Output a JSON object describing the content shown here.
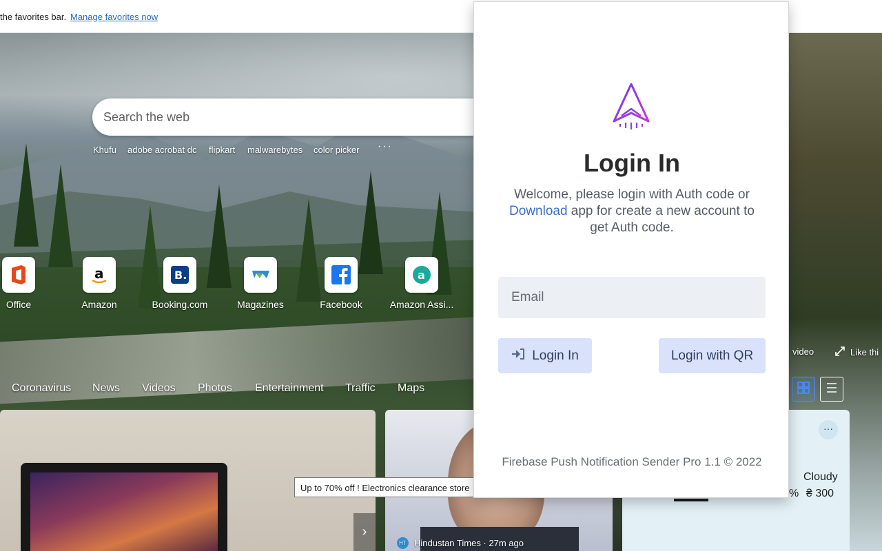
{
  "favorites_bar": {
    "text": "the favorites bar.",
    "link": "Manage favorites now"
  },
  "search": {
    "placeholder": "Search the web",
    "trending": [
      "Khufu",
      "adobe acrobat dc",
      "flipkart",
      "malwarebytes",
      "color picker"
    ],
    "more": "···"
  },
  "quick_links": [
    {
      "label": "Office",
      "icon": "office-icon"
    },
    {
      "label": "Amazon",
      "icon": "amazon-icon"
    },
    {
      "label": "Booking.com",
      "icon": "booking-icon"
    },
    {
      "label": "Magazines",
      "icon": "magazines-icon"
    },
    {
      "label": "Facebook",
      "icon": "facebook-icon"
    },
    {
      "label": "Amazon Assi...",
      "icon": "amazon-assistant-icon"
    }
  ],
  "nav_tabs": [
    "Coronavirus",
    "News",
    "Videos",
    "Photos",
    "Entertainment",
    "Traffic",
    "Maps"
  ],
  "right_labels": {
    "video": "video",
    "like": "Like thi"
  },
  "tooltip": "Up to 70% off ! Electronics clearance store",
  "news_card": {
    "source": "Hindustan Times · 27m ago",
    "source_badge": "HT"
  },
  "weather": {
    "more": "···",
    "condition": "Cloudy",
    "percent": "%",
    "aqi": "₴ 300"
  },
  "popup": {
    "title": "Login In",
    "welcome_before": "Welcome, please login with Auth code or",
    "welcome_link": "Download",
    "welcome_after": "app for create a new account to get Auth code.",
    "email_placeholder": "Email",
    "login_button": "Login In",
    "qr_button": "Login with QR",
    "footer": "Firebase Push Notification Sender Pro 1.1 © 2022",
    "accent_color": "#8b3fe6"
  }
}
